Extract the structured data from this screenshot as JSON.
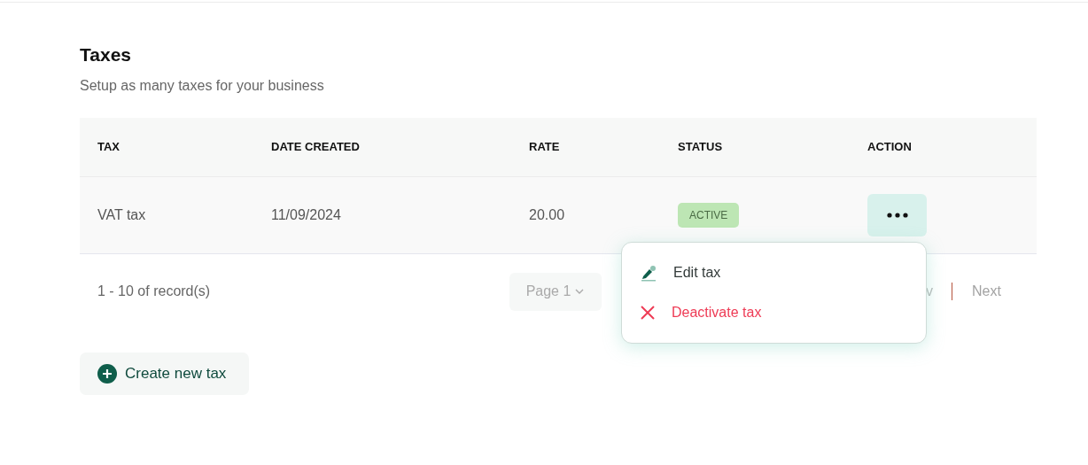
{
  "header": {
    "title": "Taxes",
    "subtitle": "Setup as many taxes for your business"
  },
  "table": {
    "columns": [
      "TAX",
      "DATE CREATED",
      "RATE",
      "STATUS",
      "ACTION"
    ],
    "rows": [
      {
        "tax": "VAT tax",
        "date_created": "11/09/2024",
        "rate": "20.00",
        "status": "ACTIVE",
        "menu_open": true
      }
    ]
  },
  "pagination": {
    "records": "1 - 10 of record(s)",
    "page": "Page 1",
    "prev_visible": "v",
    "next": "Next",
    "next_disabled": true
  },
  "action_menu": {
    "items": [
      {
        "kind": "edit",
        "label": "Edit tax"
      },
      {
        "kind": "deactivate",
        "label": "Deactivate tax"
      }
    ]
  },
  "create_button": {
    "label": "Create new tax"
  }
}
